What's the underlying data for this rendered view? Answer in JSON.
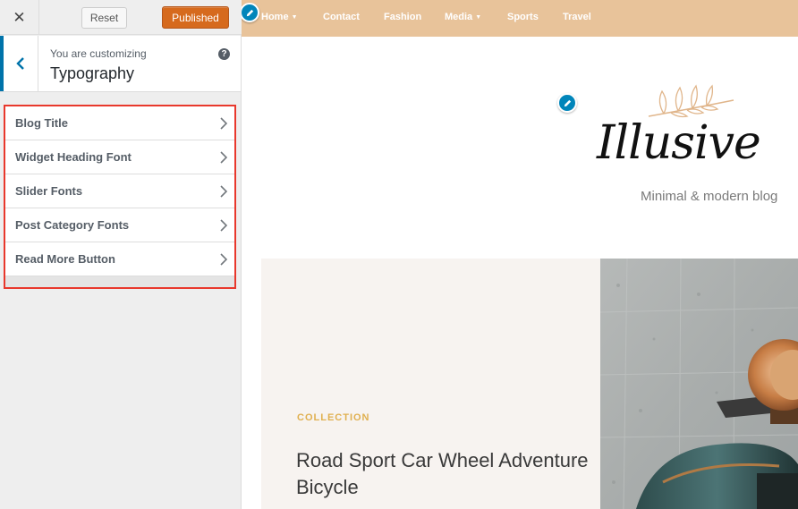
{
  "customizer": {
    "close_label": "✕",
    "reset_label": "Reset",
    "publish_label": "Published",
    "customizing_label": "You are customizing",
    "section_title": "Typography",
    "help_icon": "?",
    "panels": [
      {
        "label": "Blog Title"
      },
      {
        "label": "Widget Heading Font"
      },
      {
        "label": "Slider Fonts"
      },
      {
        "label": "Post Category Fonts"
      },
      {
        "label": "Read More Button"
      }
    ],
    "colors": {
      "accent": "#0073aa",
      "publish": "#d66a1d",
      "highlight": "#e8382c"
    }
  },
  "preview": {
    "nav": {
      "items": [
        {
          "label": "Home",
          "has_dropdown": true
        },
        {
          "label": "Contact",
          "has_dropdown": false
        },
        {
          "label": "Fashion",
          "has_dropdown": false
        },
        {
          "label": "Media",
          "has_dropdown": true
        },
        {
          "label": "Sports",
          "has_dropdown": false
        },
        {
          "label": "Travel",
          "has_dropdown": false
        }
      ],
      "background": "#e8c39a"
    },
    "logo": {
      "name": "Illusive",
      "tagline": "Minimal & modern blog"
    },
    "hero": {
      "category": "COLLECTION",
      "title": "Road Sport Car Wheel Adventure Bicycle"
    }
  }
}
